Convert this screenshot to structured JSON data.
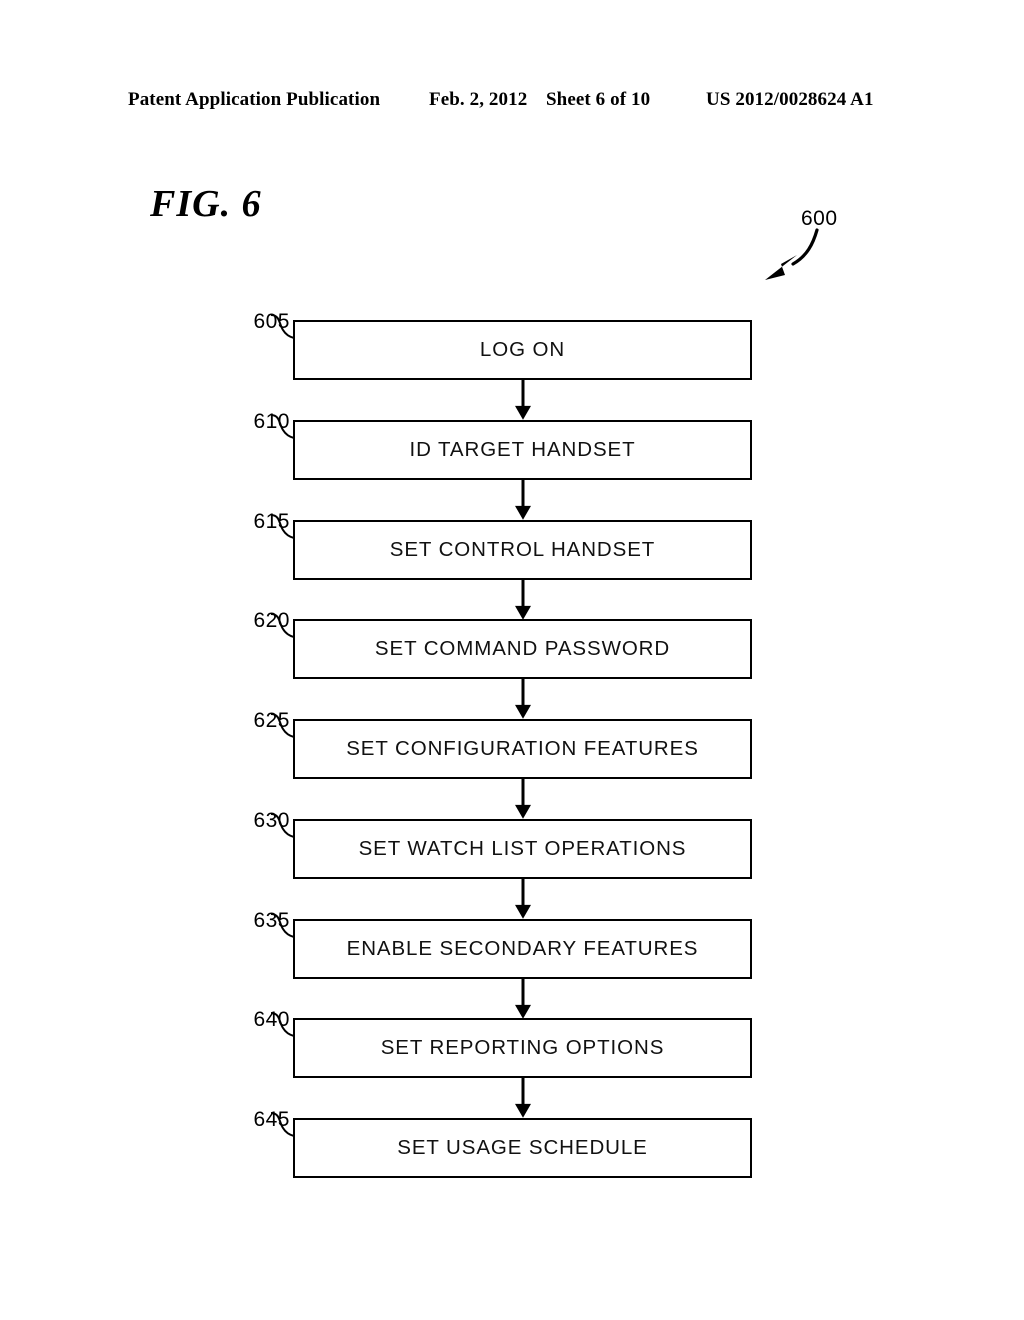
{
  "header": {
    "title": "Patent Application Publication",
    "date": "Feb. 2, 2012",
    "sheet": "Sheet 6 of 10",
    "publication_number": "US 2012/0028624 A1"
  },
  "figure": {
    "label": "FIG. 6",
    "diagram_reference": "600"
  },
  "flowchart": {
    "type": "vertical-process-flow",
    "steps": [
      {
        "ref": "605",
        "label": "LOG ON"
      },
      {
        "ref": "610",
        "label": "ID TARGET HANDSET"
      },
      {
        "ref": "615",
        "label": "SET CONTROL HANDSET"
      },
      {
        "ref": "620",
        "label": "SET COMMAND PASSWORD"
      },
      {
        "ref": "625",
        "label": "SET CONFIGURATION FEATURES"
      },
      {
        "ref": "630",
        "label": "SET WATCH LIST OPERATIONS"
      },
      {
        "ref": "635",
        "label": "ENABLE SECONDARY FEATURES"
      },
      {
        "ref": "640",
        "label": "SET REPORTING OPTIONS"
      },
      {
        "ref": "645",
        "label": "SET USAGE SCHEDULE"
      }
    ]
  },
  "colors": {
    "ink": "#000000",
    "page": "#ffffff"
  }
}
